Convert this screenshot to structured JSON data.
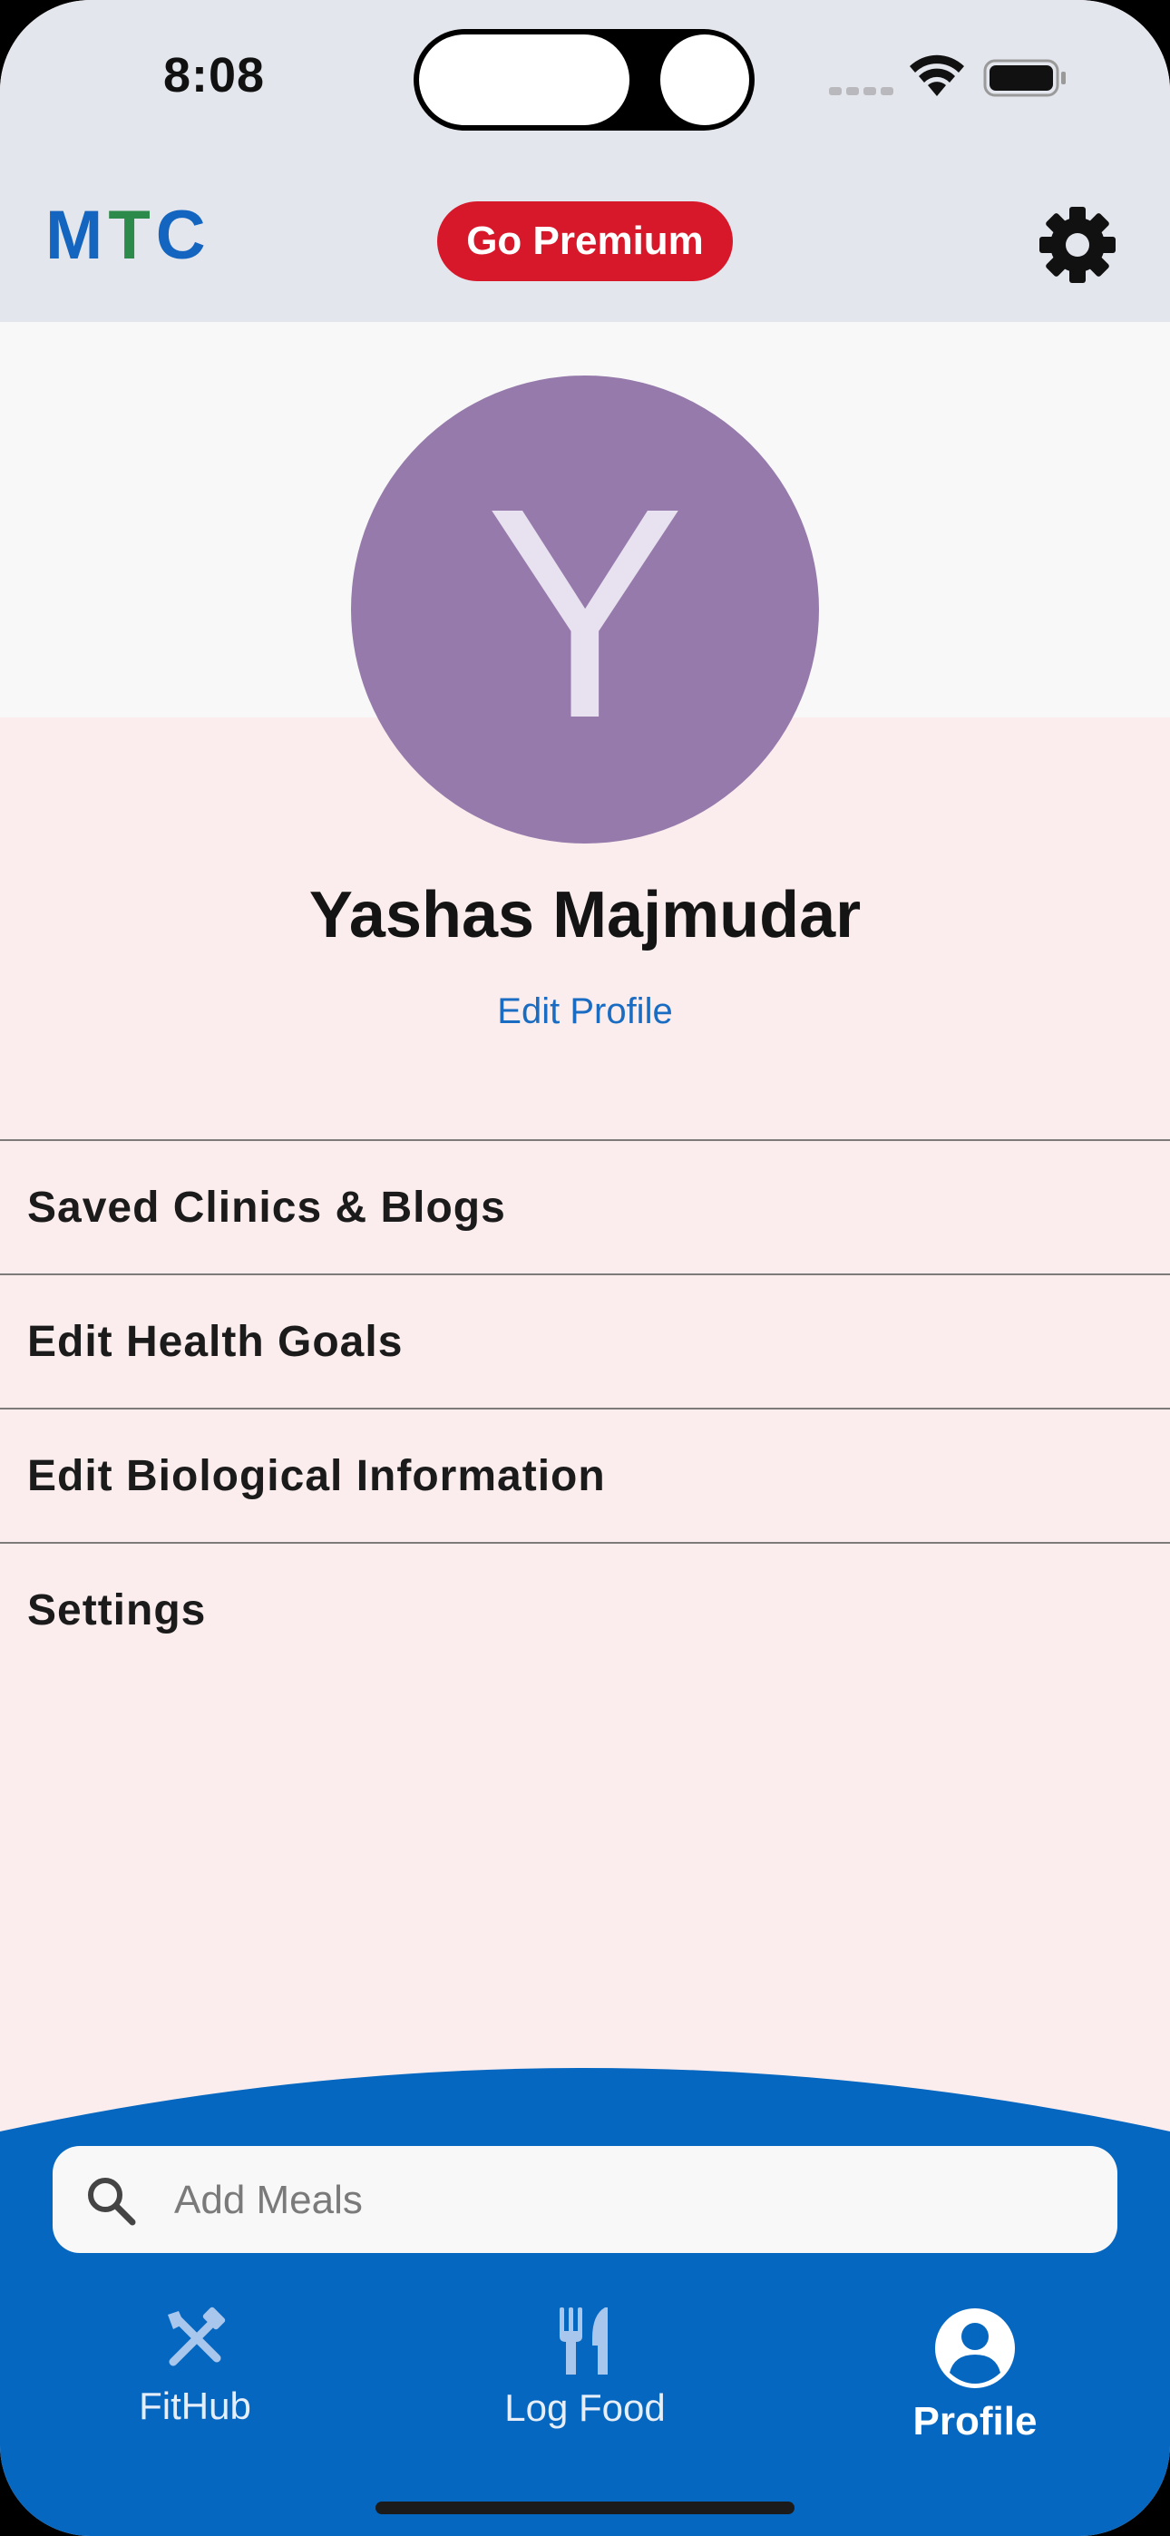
{
  "status_bar": {
    "time": "8:08"
  },
  "header": {
    "logo": {
      "m": "M",
      "t": "T",
      "c": "C"
    },
    "premium_label": "Go Premium",
    "settings_icon": "gear-icon"
  },
  "profile": {
    "avatar_letter": "Y",
    "name": "Yashas Majmudar",
    "edit_label": "Edit Profile"
  },
  "menu": {
    "items": [
      {
        "label": "Saved Clinics & Blogs"
      },
      {
        "label": "Edit Health Goals"
      },
      {
        "label": "Edit Biological Information"
      },
      {
        "label": "Settings"
      }
    ]
  },
  "search": {
    "placeholder": "Add Meals",
    "value": ""
  },
  "tabs": [
    {
      "label": "FitHub",
      "icon": "tools-icon",
      "active": false
    },
    {
      "label": "Log Food",
      "icon": "utensils-icon",
      "active": false
    },
    {
      "label": "Profile",
      "icon": "user-icon",
      "active": true
    }
  ],
  "colors": {
    "brand_blue": "#0667c0",
    "premium_red": "#d7182a",
    "avatar": "#957aab",
    "background": "#fbeded"
  }
}
